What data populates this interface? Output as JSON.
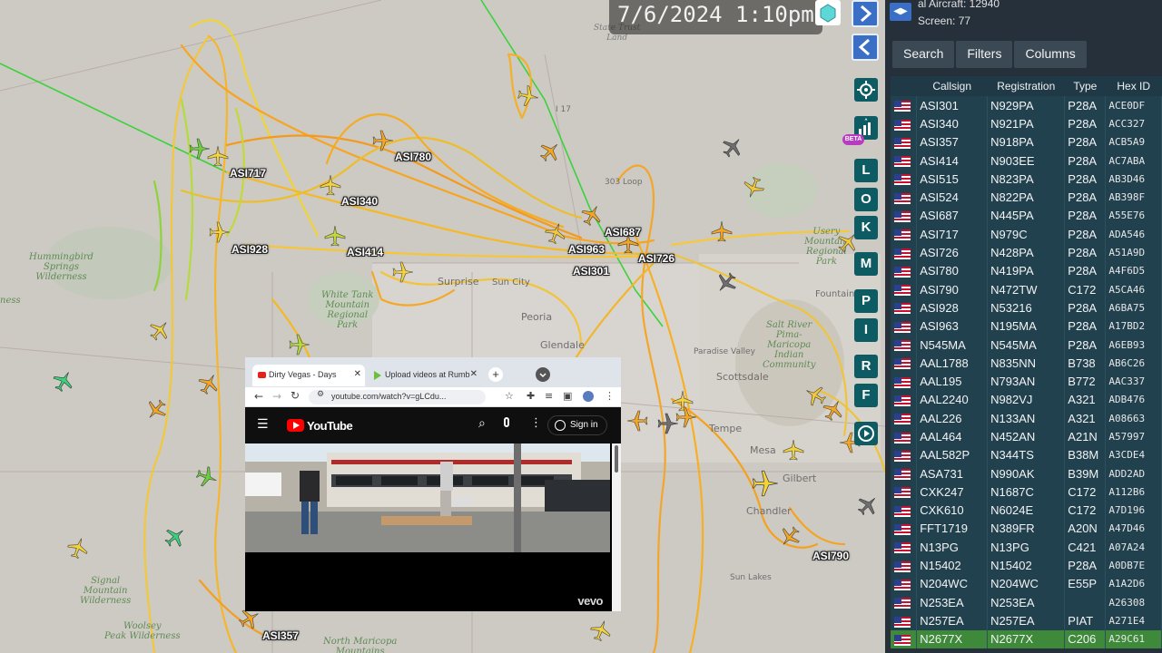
{
  "clock": "7/6/2024 1:10pm",
  "sidebar": {
    "total_aircraft": "al Aircraft: 12940",
    "on_screen": "Screen: 77",
    "tabs": [
      "Search",
      "Filters",
      "Columns"
    ],
    "columns": [
      "Callsign",
      "Registration",
      "Type",
      "Hex ID"
    ],
    "rows": [
      [
        "ASI301",
        "N929PA",
        "P28A",
        "ACE0DF"
      ],
      [
        "ASI340",
        "N921PA",
        "P28A",
        "ACC327"
      ],
      [
        "ASI357",
        "N918PA",
        "P28A",
        "ACB5A9"
      ],
      [
        "ASI414",
        "N903EE",
        "P28A",
        "AC7ABA"
      ],
      [
        "ASI515",
        "N823PA",
        "P28A",
        "AB3D46"
      ],
      [
        "ASI524",
        "N822PA",
        "P28A",
        "AB398F"
      ],
      [
        "ASI687",
        "N445PA",
        "P28A",
        "A55E76"
      ],
      [
        "ASI717",
        "N979C",
        "P28A",
        "ADA546"
      ],
      [
        "ASI726",
        "N428PA",
        "P28A",
        "A51A9D"
      ],
      [
        "ASI780",
        "N419PA",
        "P28A",
        "A4F6D5"
      ],
      [
        "ASI790",
        "N472TW",
        "C172",
        "A5CA46"
      ],
      [
        "ASI928",
        "N53216",
        "P28A",
        "A6BA75"
      ],
      [
        "ASI963",
        "N195MA",
        "P28A",
        "A17BD2"
      ],
      [
        "N545MA",
        "N545MA",
        "P28A",
        "A6EB93"
      ],
      [
        "AAL1788",
        "N835NN",
        "B738",
        "AB6C26"
      ],
      [
        "AAL195",
        "N793AN",
        "B772",
        "AAC337"
      ],
      [
        "AAL2240",
        "N982VJ",
        "A321",
        "ADB476"
      ],
      [
        "AAL226",
        "N133AN",
        "A321",
        "A08663"
      ],
      [
        "AAL464",
        "N452AN",
        "A21N",
        "A57997"
      ],
      [
        "AAL582P",
        "N344TS",
        "B38M",
        "A3CDE4"
      ],
      [
        "ASA731",
        "N990AK",
        "B39M",
        "ADD2AD"
      ],
      [
        "CXK247",
        "N1687C",
        "C172",
        "A112B6"
      ],
      [
        "CXK610",
        "N6024E",
        "C172",
        "A7D196"
      ],
      [
        "FFT1719",
        "N389FR",
        "A20N",
        "A47D46"
      ],
      [
        "N13PG",
        "N13PG",
        "C421",
        "A07A24"
      ],
      [
        "N15402",
        "N15402",
        "P28A",
        "A0DB7E"
      ],
      [
        "N204WC",
        "N204WC",
        "E55P",
        "A1A2D6"
      ],
      [
        "N253EA",
        "N253EA",
        "",
        "A26308"
      ],
      [
        "N257EA",
        "N257EA",
        "PIAT",
        "A271E4"
      ],
      [
        "N2677X",
        "N2677X",
        "C206",
        "A29C61"
      ]
    ],
    "selected_row": "N2677X"
  },
  "map": {
    "callsign_labels": [
      "ASI717",
      "ASI780",
      "ASI340",
      "ASI928",
      "ASI414",
      "ASI687",
      "ASI963",
      "ASI301",
      "ASI726",
      "ASI790",
      "ASI357"
    ],
    "places": {
      "hummingbird": "Hummingbird\nSprings\nWilderness",
      "white_tank": "White Tank\nMountain\nRegional\nPark",
      "surprise": "Surprise",
      "sun_city": "Sun City",
      "peoria": "Peoria",
      "glendale": "Glendale",
      "scottsdale": "Scottsdale",
      "tempe": "Tempe",
      "mesa": "Mesa",
      "gilbert": "Gilbert",
      "chandler": "Chandler",
      "sun_lakes": "Sun Lakes",
      "signal": "Signal\nMountain\nWilderness",
      "woolsey": "Woolsey\nPeak Wilderness",
      "north_maricopa": "North Maricopa\nMountains",
      "salt_river": "Salt River\nPima-\nMaricopa\nIndian\nCommunity",
      "usery": "Usery\nMountain\nRegional\nPark",
      "fountain": "Fountain",
      "paradise_valley": "Paradise Valley",
      "loop303": "303 Loop",
      "i17": "I 17",
      "state_trust": "State Trust\nLand",
      "ness": "ness"
    },
    "buttons": [
      "L",
      "O",
      "K",
      "M",
      "P",
      "I",
      "R",
      "F"
    ],
    "beta_label": "BETA"
  },
  "video": {
    "tab1": "Dirty Vegas - Days",
    "tab2": "Upload videos at Rumb",
    "url": "youtube.com/watch?v=gLCdu...",
    "logo": "YouTube",
    "sign_in": "Sign in",
    "watermark": "vevo"
  },
  "colors": {
    "track_orange": "#f4a623",
    "track_yellow": "#f3d23a",
    "track_green": "#7fd13b",
    "sidebar_bg": "#25303a",
    "row_selected": "#3e8a3a",
    "button_teal": "#0d5c63",
    "button_blue": "#3a6fc5"
  }
}
